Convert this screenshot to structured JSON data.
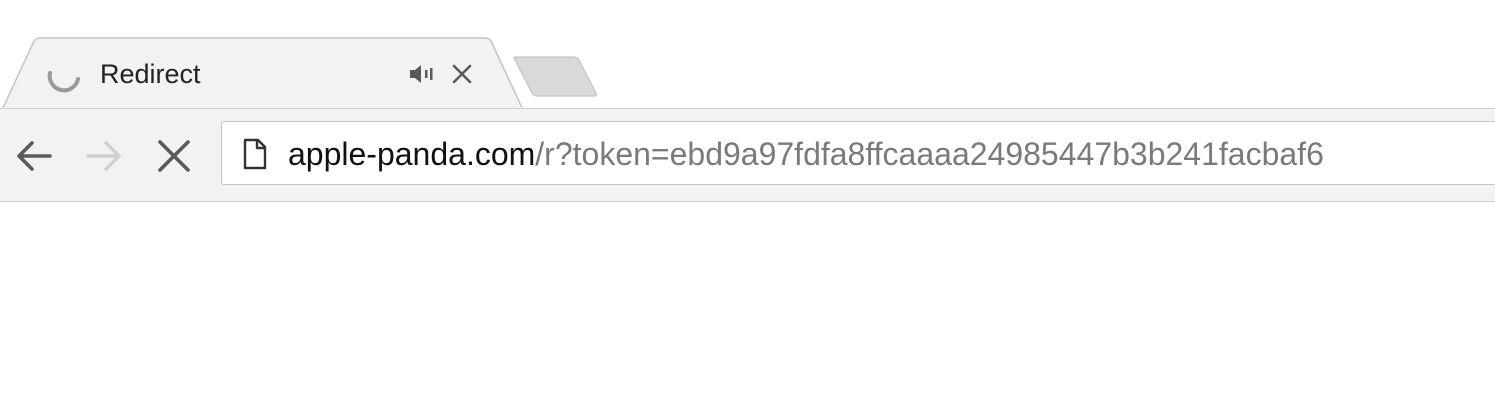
{
  "tabs": [
    {
      "title": "Redirect",
      "state": "loading",
      "audio_icon": "speaker-icon",
      "close_icon": "close-icon"
    }
  ],
  "new_tab_icon": "new-tab-icon",
  "toolbar": {
    "back_icon": "arrow-left-icon",
    "forward_icon": "arrow-right-icon",
    "stop_icon": "stop-icon"
  },
  "omnibox": {
    "page_icon": "document-icon",
    "url_host": "apple-panda.com",
    "url_path": "/r?token=ebd9a97fdfa8ffcaaaa24985447b3b241facbaf6"
  },
  "colors": {
    "tab_background": "#f2f2f2",
    "toolbar_background": "#f2f2f2",
    "inactive_tab": "#d9d9d9",
    "url_host_text": "#111111",
    "url_path_text": "#7a7a7a"
  }
}
